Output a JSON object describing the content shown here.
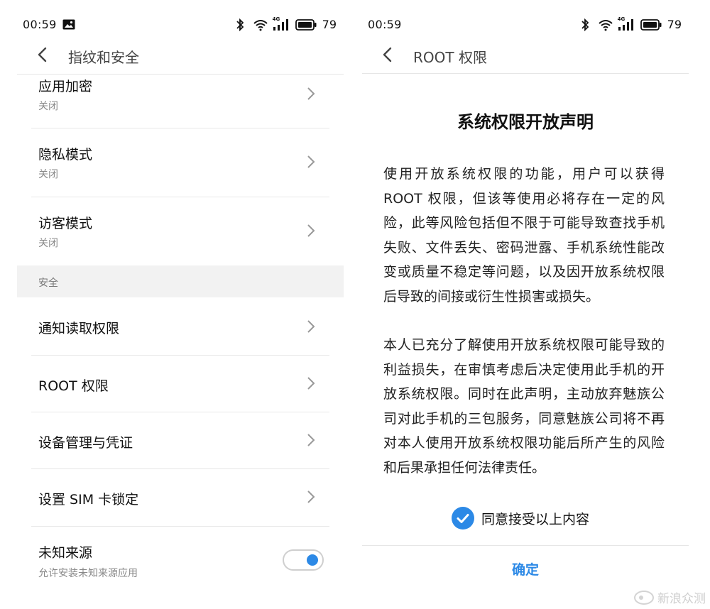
{
  "status_left": {
    "time": "00:59",
    "battery": "79",
    "signal_badge": "4G"
  },
  "status_right": {
    "time": "00:59",
    "battery": "79",
    "signal_badge": "4G"
  },
  "left_screen": {
    "title": "指纹和安全",
    "items_top": [
      {
        "title": "应用加密",
        "subtitle": "关闭"
      },
      {
        "title": "隐私模式",
        "subtitle": "关闭"
      },
      {
        "title": "访客模式",
        "subtitle": "关闭"
      }
    ],
    "section_label": "安全",
    "items_security": [
      {
        "title": "通知读取权限"
      },
      {
        "title": "ROOT 权限"
      },
      {
        "title": "设备管理与凭证"
      },
      {
        "title": "设置 SIM 卡锁定"
      }
    ],
    "unknown_source": {
      "title": "未知来源",
      "subtitle": "允许安装未知来源应用",
      "enabled": true
    }
  },
  "right_screen": {
    "title": "ROOT 权限",
    "heading": "系统权限开放声明",
    "paragraph1": "使用开放系统权限的功能，用户可以获得ROOT 权限，但该等使用必将存在一定的风险，此等风险包括但不限于可能导致查找手机失败、文件丢失、密码泄露、手机系统性能改变或质量不稳定等问题，以及因开放系统权限后导致的间接或衍生性损害或损失。",
    "paragraph2": "本人已充分了解使用开放系统权限可能导致的利益损失，在审慎考虑后决定使用此手机的开放系统权限。同时在此声明，主动放弃魅族公司对此手机的三包服务，同意魅族公司将不再对本人使用开放系统权限功能后所产生的风险和后果承担任何法律责任。",
    "agree_label": "同意接受以上内容",
    "agree_checked": true,
    "confirm_label": "确定"
  },
  "watermark": "新浪众测",
  "colors": {
    "accent": "#2c89e6",
    "section_bg": "#f2f2f2",
    "subtitle": "#888888"
  },
  "icons": [
    "image-icon",
    "bluetooth-icon",
    "wifi-icon",
    "cell-signal-icon",
    "battery-icon",
    "back-arrow-icon",
    "chevron-right-icon",
    "check-icon"
  ]
}
